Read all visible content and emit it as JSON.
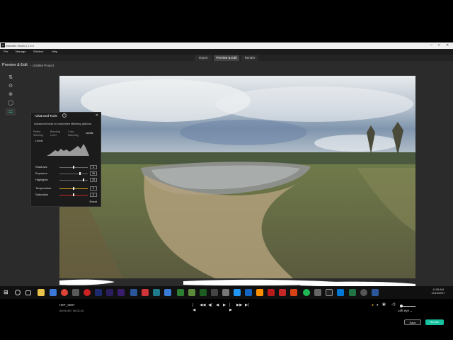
{
  "window": {
    "title": "Insta360 Studio | 1.3.0",
    "controls": [
      "–",
      "□",
      "✕"
    ]
  },
  "menu": [
    "File",
    "Manage",
    "Window",
    "Help"
  ],
  "tabs": [
    {
      "label": "Import",
      "active": false
    },
    {
      "label": "Preview & Edit",
      "active": true
    },
    {
      "label": "Render",
      "active": false
    }
  ],
  "header": {
    "mode": "Preview & Edit",
    "project": "- Untitled Project"
  },
  "toolbar_icons": [
    "flip-icon",
    "reset-view-icon",
    "stabilize-icon",
    "lens-icon",
    "advanced-tools-icon"
  ],
  "advanced_tools": {
    "title": "Advanced Tools",
    "help": "?",
    "close": "✕",
    "description": "Advanced tools to customize stitching options.",
    "subtabs": [
      "Refine Stitching",
      "Blending Level",
      "Color Matching",
      "Levels"
    ],
    "active_subtab": "Levels",
    "levels_label": "Levels",
    "sliders": [
      {
        "label": "Shadows",
        "value": "0",
        "level": 0.5,
        "color": "#666666"
      },
      {
        "label": "Exposure",
        "value": "16",
        "level": 0.72,
        "color": "#666666"
      },
      {
        "label": "Highlights",
        "value": "70",
        "level": 0.85,
        "color": "#666666"
      },
      {
        "label": "Temperature",
        "value": "0",
        "level": 0.5,
        "color": "#d9a81e"
      },
      {
        "label": "Saturation",
        "value": "0",
        "level": 0.5,
        "color": "#cc2a2a"
      }
    ],
    "reset": "Reset"
  },
  "playback": {
    "clip_name": "HET_0007",
    "timecode": "00:00:49 / 00:01:10",
    "progress": 0.45,
    "transport": [
      "|◀",
      "◀◀",
      "◀|",
      "◀",
      "▶",
      "|▶",
      "▶▶",
      "▶|"
    ],
    "eye_mode": "Left eye ⌄"
  },
  "buttons": {
    "save": "Save",
    "render": "Render"
  },
  "colors": {
    "accent": "#16c1a0",
    "panel": "#2b2b2b"
  },
  "taskbar": {
    "time": "11:55 AM",
    "date": "10/15/2017"
  }
}
